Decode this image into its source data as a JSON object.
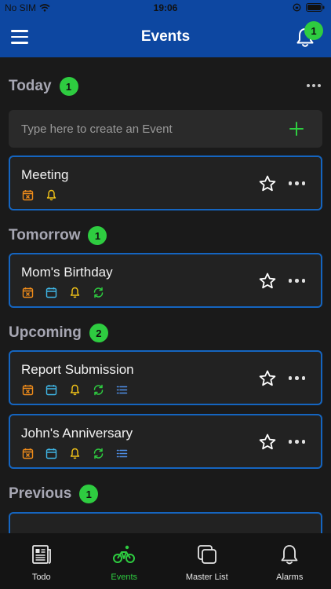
{
  "status_bar": {
    "carrier": "No SIM",
    "time": "19:06"
  },
  "header": {
    "title": "Events",
    "notification_count": "1"
  },
  "today": {
    "title": "Today",
    "count": "1"
  },
  "create": {
    "placeholder": "Type here to create an Event"
  },
  "tomorrow": {
    "title": "Tomorrow",
    "count": "1"
  },
  "upcoming": {
    "title": "Upcoming",
    "count": "2"
  },
  "previous": {
    "title": "Previous",
    "count": "1"
  },
  "events": [
    {
      "title": "Meeting",
      "icons": [
        "calendar-x-icon",
        "bell-icon"
      ]
    },
    {
      "title": "Mom's Birthday",
      "icons": [
        "calendar-x-icon",
        "calendar-icon",
        "bell-icon",
        "repeat-icon"
      ]
    },
    {
      "title": "Report Submission",
      "icons": [
        "calendar-x-icon",
        "calendar-icon",
        "bell-icon",
        "repeat-icon",
        "list-icon"
      ]
    },
    {
      "title": "John's Anniversary",
      "icons": [
        "calendar-x-icon",
        "calendar-icon",
        "bell-icon",
        "repeat-icon",
        "list-icon"
      ]
    }
  ],
  "nav": [
    {
      "label": "Todo",
      "icon": "newspaper-icon",
      "active": false
    },
    {
      "label": "Events",
      "icon": "bicycle-icon",
      "active": true
    },
    {
      "label": "Master List",
      "icon": "stacked-squares-icon",
      "active": false
    },
    {
      "label": "Alarms",
      "icon": "bell-icon",
      "active": false
    }
  ],
  "colors": {
    "header_bg": "#0d47a1",
    "card_border": "#1565c0",
    "badge": "#2ecc40",
    "icon_orange": "#f08c1a",
    "icon_cyan": "#3fb6e6",
    "icon_yellow": "#f2c318",
    "icon_green": "#2ecc40",
    "icon_blue": "#4f8fe8"
  }
}
